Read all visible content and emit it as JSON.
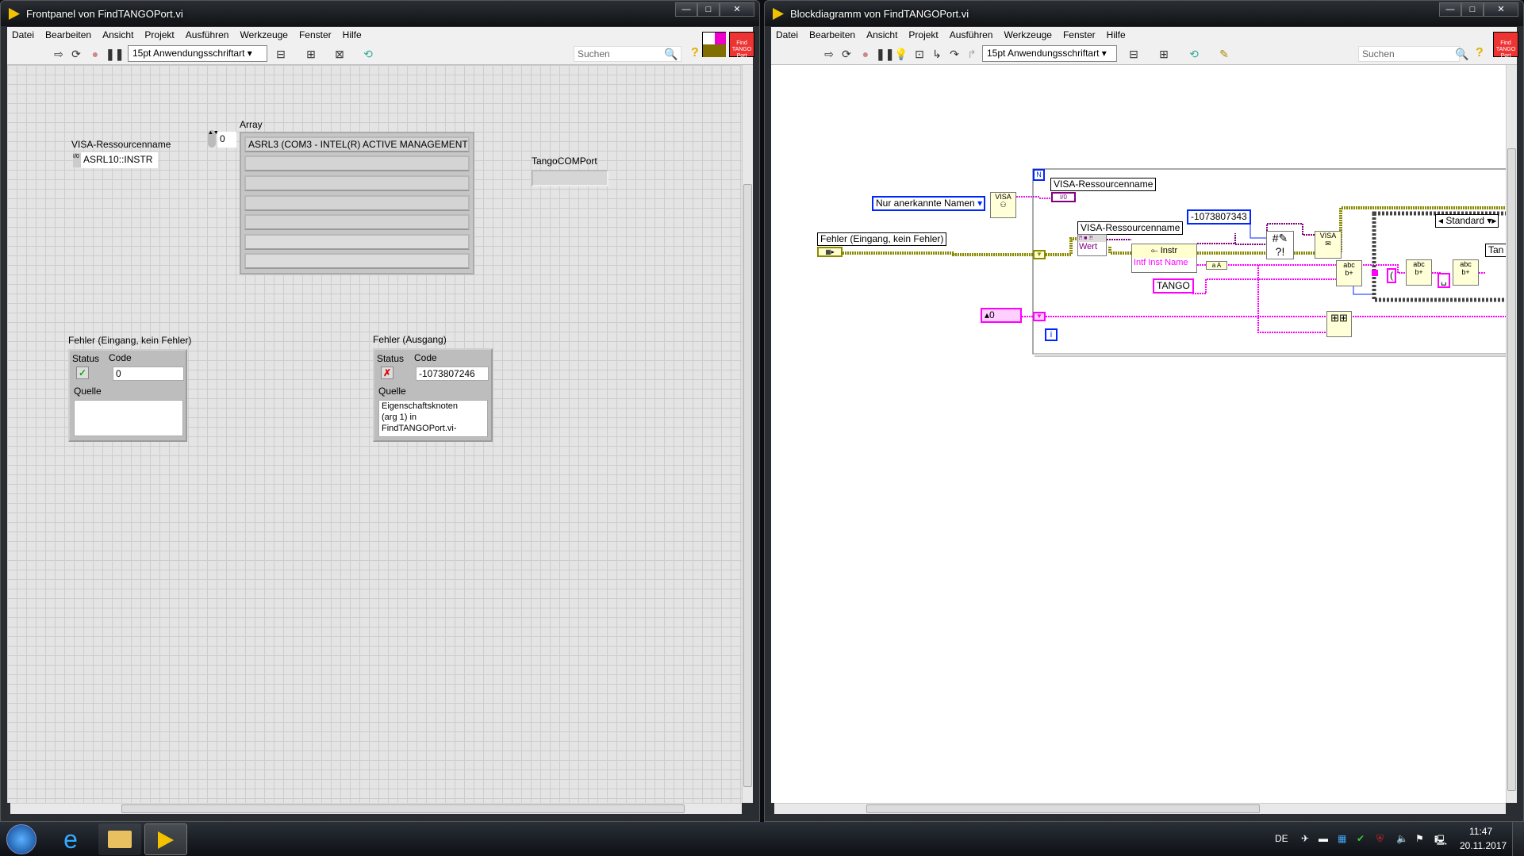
{
  "front_panel": {
    "title": "Frontpanel von FindTANGOPort.vi",
    "menu": [
      "Datei",
      "Bearbeiten",
      "Ansicht",
      "Projekt",
      "Ausführen",
      "Werkzeuge",
      "Fenster",
      "Hilfe"
    ],
    "font_select": "15pt Anwendungsschriftart",
    "search_placeholder": "Suchen",
    "help": "?",
    "vi_icon_text": "Find TANGO Port",
    "visa": {
      "label": "VISA-Ressourcenname",
      "value": "ASRL10::INSTR",
      "io_glyph": "I/0"
    },
    "array": {
      "label": "Array",
      "index": "0",
      "items": [
        "ASRL3  (COM3 - INTEL(R) ACTIVE MANAGEMENT",
        "",
        "",
        "",
        "",
        "",
        ""
      ]
    },
    "tango_port": {
      "label": "TangoCOMPort",
      "value": ""
    },
    "error_in": {
      "label": "Fehler (Eingang, kein Fehler)",
      "status_label": "Status",
      "code_label": "Code",
      "code": "0",
      "source_label": "Quelle",
      "source": "",
      "status_glyph": "✓"
    },
    "error_out": {
      "label": "Fehler (Ausgang)",
      "status_label": "Status",
      "code_label": "Code",
      "code": "-1073807246",
      "source_label": "Quelle",
      "source": "Eigenschaftsknoten (arg 1) in FindTANGOPort.vi-",
      "status_glyph": "✗"
    }
  },
  "block_diagram": {
    "title": "Blockdiagramm von FindTANGOPort.vi",
    "menu": [
      "Datei",
      "Bearbeiten",
      "Ansicht",
      "Projekt",
      "Ausführen",
      "Werkzeuge",
      "Fenster",
      "Hilfe"
    ],
    "font_select": "15pt Anwendungsschriftart",
    "search_placeholder": "Suchen",
    "help": "?",
    "vi_icon_text": "Find TANGO Port",
    "ring_constant": "Nur anerkannte Namen",
    "visa_label": "VISA-Ressourcenname",
    "io_terminal": "I/0",
    "error_label": "Fehler (Eingang, kein Fehler)",
    "property_label": "VISA-Ressourcenname",
    "property_item": "Wert",
    "instr_node": "Instr",
    "instr_property": "Intf Inst Name",
    "error_code_constant": "-1073807343",
    "tango_constant": "TANGO",
    "case_selector": "Standard",
    "paren_constant": "(",
    "space_constant": "␣",
    "tango_indicator": "Tan",
    "zero_constant": "0",
    "loop_count": "N",
    "iteration": "i",
    "visa_find": "VISA",
    "visa_close": "VISA",
    "to_upper": "a A"
  },
  "taskbar": {
    "language": "DE",
    "time": "11:47",
    "date": "20.11.2017"
  },
  "colors": {
    "error_wire": "#8a8a00",
    "string_wire": "#ff00ff",
    "visa_wire": "#800080",
    "numeric_blue": "#0026ff"
  }
}
